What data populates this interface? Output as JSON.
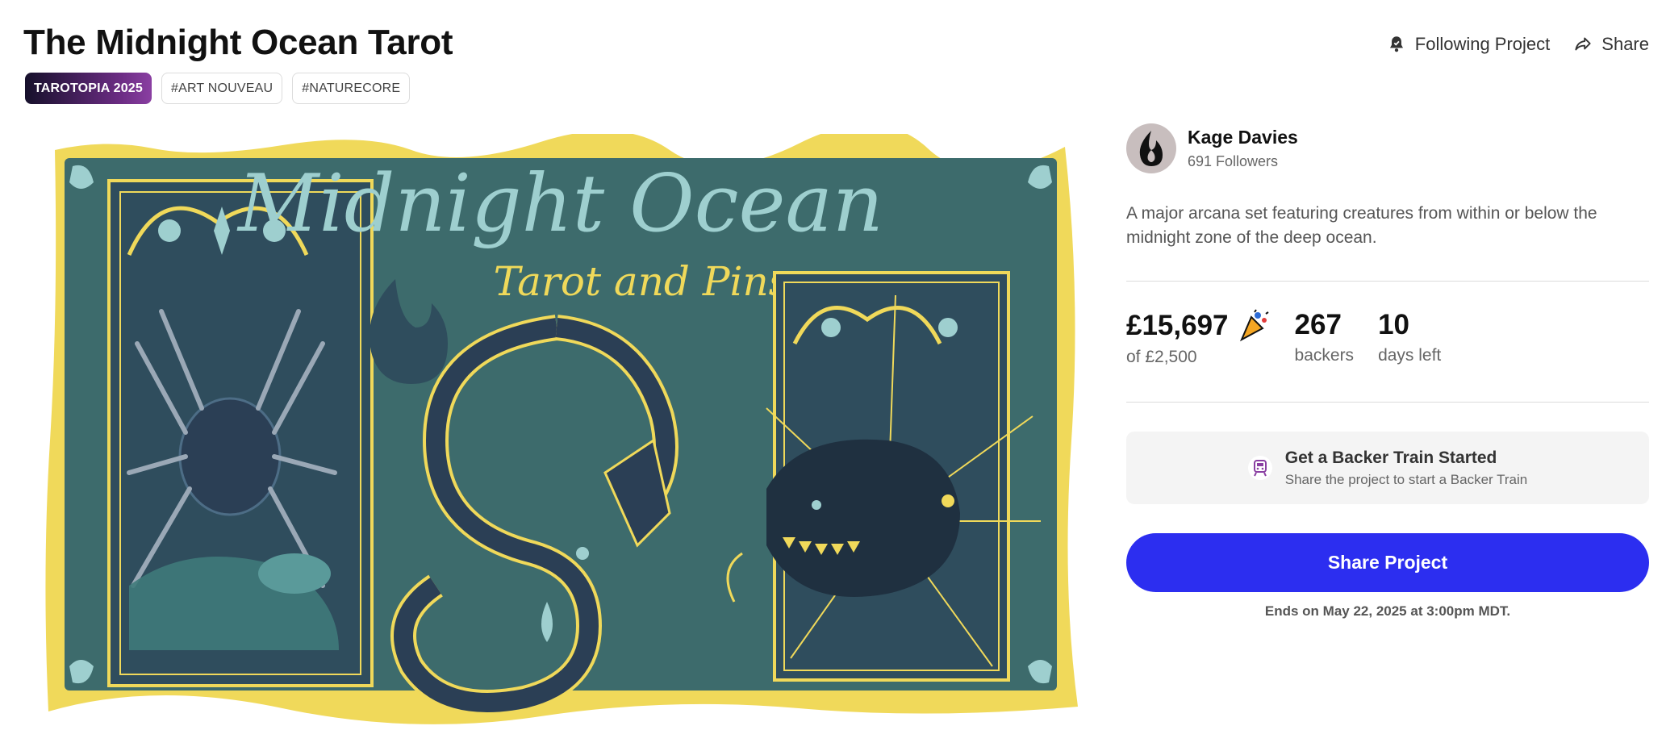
{
  "project": {
    "title": "The Midnight Ocean Tarot",
    "tags": [
      "TAROTOPIA 2025",
      "#ART NOUVEAU",
      "#NATURECORE"
    ]
  },
  "actions": {
    "follow_label": "Following Project",
    "share_label": "Share"
  },
  "hero": {
    "title": "Midnight Ocean",
    "subtitle": "Tarot and Pins"
  },
  "creator": {
    "name": "Kage Davies",
    "followers": "691 Followers"
  },
  "description": "A major arcana set featuring creatures from within or below the midnight zone of the deep ocean.",
  "stats": {
    "pledged": "£15,697",
    "goal": "of £2,500",
    "backers": "267",
    "backers_label": "backers",
    "days": "10",
    "days_label": "days left"
  },
  "backer_train": {
    "title": "Get a Backer Train Started",
    "subtitle": "Share the project to start a Backer Train"
  },
  "cta": {
    "share_project": "Share Project"
  },
  "ends_text": "Ends on May 22, 2025 at 3:00pm MDT.",
  "colors": {
    "accent": "#2c2ef0",
    "hero_bg": "#3d6b6c",
    "hero_border": "#f0d95a"
  }
}
